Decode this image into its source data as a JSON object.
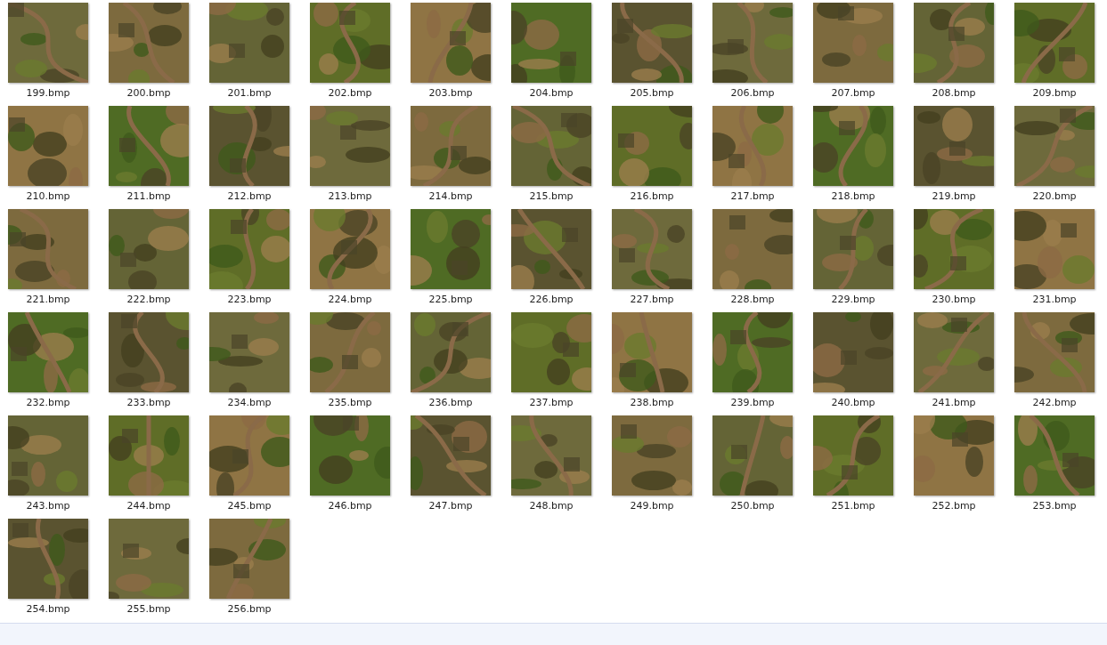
{
  "files": [
    {
      "name": "199.bmp"
    },
    {
      "name": "200.bmp"
    },
    {
      "name": "201.bmp"
    },
    {
      "name": "202.bmp"
    },
    {
      "name": "203.bmp"
    },
    {
      "name": "204.bmp"
    },
    {
      "name": "205.bmp"
    },
    {
      "name": "206.bmp"
    },
    {
      "name": "207.bmp"
    },
    {
      "name": "208.bmp"
    },
    {
      "name": "209.bmp"
    },
    {
      "name": "210.bmp"
    },
    {
      "name": "211.bmp"
    },
    {
      "name": "212.bmp"
    },
    {
      "name": "213.bmp"
    },
    {
      "name": "214.bmp"
    },
    {
      "name": "215.bmp"
    },
    {
      "name": "216.bmp"
    },
    {
      "name": "217.bmp"
    },
    {
      "name": "218.bmp"
    },
    {
      "name": "219.bmp"
    },
    {
      "name": "220.bmp"
    },
    {
      "name": "221.bmp"
    },
    {
      "name": "222.bmp"
    },
    {
      "name": "223.bmp"
    },
    {
      "name": "224.bmp"
    },
    {
      "name": "225.bmp"
    },
    {
      "name": "226.bmp"
    },
    {
      "name": "227.bmp"
    },
    {
      "name": "228.bmp"
    },
    {
      "name": "229.bmp"
    },
    {
      "name": "230.bmp"
    },
    {
      "name": "231.bmp"
    },
    {
      "name": "232.bmp"
    },
    {
      "name": "233.bmp"
    },
    {
      "name": "234.bmp"
    },
    {
      "name": "235.bmp"
    },
    {
      "name": "236.bmp"
    },
    {
      "name": "237.bmp"
    },
    {
      "name": "238.bmp"
    },
    {
      "name": "239.bmp"
    },
    {
      "name": "240.bmp"
    },
    {
      "name": "241.bmp"
    },
    {
      "name": "242.bmp"
    },
    {
      "name": "243.bmp"
    },
    {
      "name": "244.bmp"
    },
    {
      "name": "245.bmp"
    },
    {
      "name": "246.bmp"
    },
    {
      "name": "247.bmp"
    },
    {
      "name": "248.bmp"
    },
    {
      "name": "249.bmp"
    },
    {
      "name": "250.bmp"
    },
    {
      "name": "251.bmp"
    },
    {
      "name": "252.bmp"
    },
    {
      "name": "253.bmp"
    },
    {
      "name": "254.bmp"
    },
    {
      "name": "255.bmp"
    },
    {
      "name": "256.bmp"
    }
  ]
}
